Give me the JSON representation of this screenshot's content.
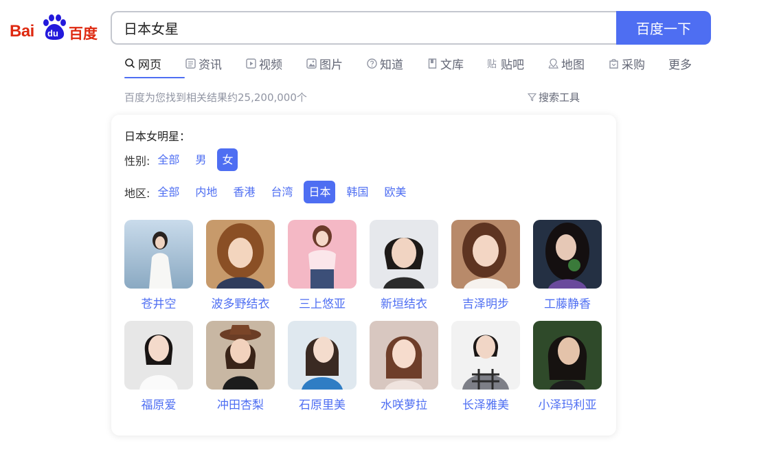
{
  "logo": {
    "bai": "Bai",
    "du": "du",
    "cn": "百度"
  },
  "search": {
    "query": "日本女星",
    "button_label": "百度一下"
  },
  "tabs": [
    {
      "label": "网页",
      "icon": "search-icon"
    },
    {
      "label": "资讯",
      "icon": "news-icon"
    },
    {
      "label": "视频",
      "icon": "video-icon"
    },
    {
      "label": "图片",
      "icon": "image-icon"
    },
    {
      "label": "知道",
      "icon": "question-icon"
    },
    {
      "label": "文库",
      "icon": "document-icon"
    },
    {
      "label": "贴吧",
      "icon": "tieba-icon"
    },
    {
      "label": "地图",
      "icon": "map-icon"
    },
    {
      "label": "采购",
      "icon": "shop-icon"
    },
    {
      "label": "更多",
      "icon": ""
    }
  ],
  "result_count": "百度为您找到相关结果约25,200,000个",
  "search_tools": "搜索工具",
  "card": {
    "title": "日本女明星：",
    "gender": {
      "label": "性别:",
      "options": [
        "全部",
        "男",
        "女"
      ],
      "selected": "女"
    },
    "region": {
      "label": "地区:",
      "options": [
        "全部",
        "内地",
        "香港",
        "台湾",
        "日本",
        "韩国",
        "欧美"
      ],
      "selected": "日本"
    },
    "stars": [
      {
        "name": "苍井空"
      },
      {
        "name": "波多野结衣"
      },
      {
        "name": "三上悠亚"
      },
      {
        "name": "新垣结衣"
      },
      {
        "name": "吉泽明步"
      },
      {
        "name": "工藤静香"
      },
      {
        "name": "福原爱"
      },
      {
        "name": "冲田杏梨"
      },
      {
        "name": "石原里美"
      },
      {
        "name": "水咲萝拉"
      },
      {
        "name": "长泽雅美"
      },
      {
        "name": "小泽玛利亚"
      }
    ]
  },
  "colors": {
    "brand_blue": "#4e6ef2",
    "logo_red": "#de2910",
    "logo_blue": "#2319dc",
    "muted": "#9195a3"
  }
}
